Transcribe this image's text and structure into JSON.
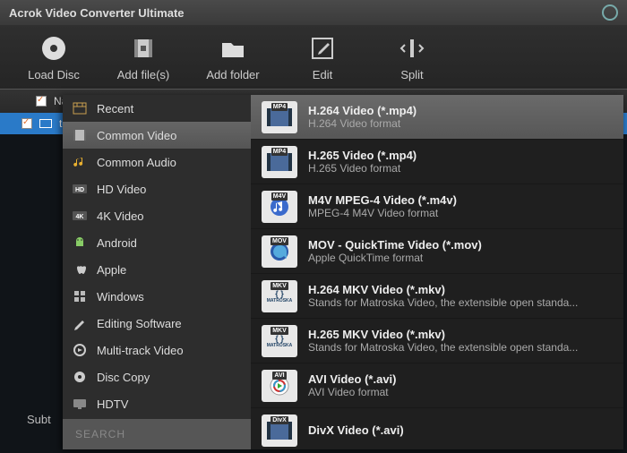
{
  "app_title": "Acrok Video Converter Ultimate",
  "toolbar": [
    {
      "label": "Load Disc",
      "icon": "disc"
    },
    {
      "label": "Add file(s)",
      "icon": "film"
    },
    {
      "label": "Add folder",
      "icon": "folder"
    },
    {
      "label": "Edit",
      "icon": "edit"
    },
    {
      "label": "Split",
      "icon": "split"
    }
  ],
  "filelist": {
    "header_name": "Nam",
    "rows": [
      {
        "name": "tos"
      }
    ]
  },
  "subtitles_label": "Subt",
  "categories": [
    {
      "label": "Recent",
      "icon": "recent"
    },
    {
      "label": "Common Video",
      "icon": "video"
    },
    {
      "label": "Common Audio",
      "icon": "audio"
    },
    {
      "label": "HD Video",
      "icon": "hd"
    },
    {
      "label": "4K Video",
      "icon": "4k"
    },
    {
      "label": "Android",
      "icon": "android"
    },
    {
      "label": "Apple",
      "icon": "apple"
    },
    {
      "label": "Windows",
      "icon": "windows"
    },
    {
      "label": "Editing Software",
      "icon": "editing"
    },
    {
      "label": "Multi-track Video",
      "icon": "multitrack"
    },
    {
      "label": "Disc Copy",
      "icon": "disccopy"
    },
    {
      "label": "HDTV",
      "icon": "hdtv"
    }
  ],
  "selected_category_index": 1,
  "search_placeholder": "SEARCH",
  "formats": [
    {
      "tag": "MP4",
      "title": "H.264 Video (*.mp4)",
      "desc": "H.264 Video format",
      "thumb": "film"
    },
    {
      "tag": "MP4",
      "title": "H.265 Video (*.mp4)",
      "desc": "H.265 Video format",
      "thumb": "film"
    },
    {
      "tag": "M4V",
      "title": "M4V MPEG-4 Video (*.m4v)",
      "desc": "MPEG-4 M4V Video format",
      "thumb": "itunes"
    },
    {
      "tag": "MOV",
      "title": "MOV - QuickTime Video (*.mov)",
      "desc": "Apple QuickTime format",
      "thumb": "quicktime"
    },
    {
      "tag": "MKV",
      "title": "H.264 MKV Video (*.mkv)",
      "desc": "Stands for Matroska Video, the extensible open standa...",
      "thumb": "mkv"
    },
    {
      "tag": "MKV",
      "title": "H.265 MKV Video (*.mkv)",
      "desc": "Stands for Matroska Video, the extensible open standa...",
      "thumb": "mkv"
    },
    {
      "tag": "AVI",
      "title": "AVI Video (*.avi)",
      "desc": "AVI Video format",
      "thumb": "avi"
    },
    {
      "tag": "DivX",
      "title": "DivX Video (*.avi)",
      "desc": "",
      "thumb": "film"
    }
  ],
  "selected_format_index": 0
}
